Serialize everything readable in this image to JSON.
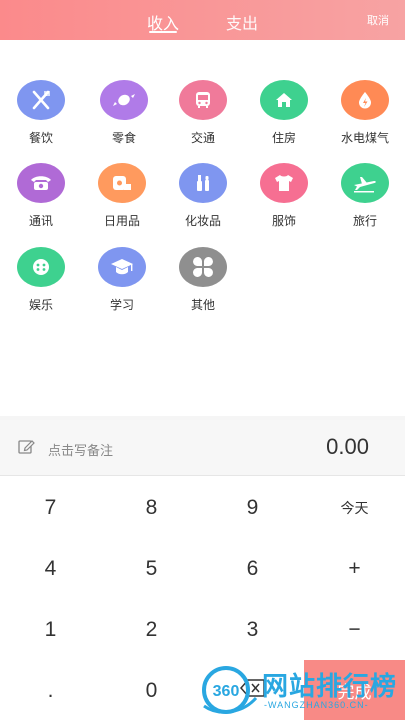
{
  "header": {
    "tabs": [
      {
        "label": "收入",
        "active": true
      },
      {
        "label": "支出",
        "active": false
      }
    ],
    "cancel_label": "取消",
    "color": "#fb8a8b"
  },
  "categories": [
    {
      "label": "餐饮",
      "icon": "utensils-icon",
      "color": "#7f96f0"
    },
    {
      "label": "零食",
      "icon": "candy-icon",
      "color": "#b07be8"
    },
    {
      "label": "交通",
      "icon": "bus-icon",
      "color": "#f07a9a"
    },
    {
      "label": "住房",
      "icon": "house-icon",
      "color": "#3ed18f"
    },
    {
      "label": "水电煤气",
      "icon": "utility-drop-icon",
      "color": "#ff8a55"
    },
    {
      "label": "通讯",
      "icon": "telephone-icon",
      "color": "#b06ad6"
    },
    {
      "label": "日用品",
      "icon": "tissue-roll-icon",
      "color": "#ff9a5e"
    },
    {
      "label": "化妆品",
      "icon": "cosmetics-icon",
      "color": "#7f96f0"
    },
    {
      "label": "服饰",
      "icon": "tshirt-icon",
      "color": "#f66f92"
    },
    {
      "label": "旅行",
      "icon": "airplane-icon",
      "color": "#3ed18f"
    },
    {
      "label": "娱乐",
      "icon": "gamepad-icon",
      "color": "#3ed18f"
    },
    {
      "label": "学习",
      "icon": "graduation-cap-icon",
      "color": "#7f96f0"
    },
    {
      "label": "其他",
      "icon": "clover-icon",
      "color": "#8f8f8f"
    }
  ],
  "note": {
    "placeholder": "点击写备注",
    "amount": "0.00"
  },
  "keypad": {
    "keys": [
      "7",
      "8",
      "9",
      "今天",
      "4",
      "5",
      "6",
      "+",
      "1",
      "2",
      "3",
      "−",
      ".",
      "0",
      "",
      "完成"
    ],
    "done_color": "#f88a86"
  },
  "watermark": {
    "brand": "360",
    "title": "网站排行榜",
    "subtitle": "-WANGZHAN360.CN-"
  }
}
